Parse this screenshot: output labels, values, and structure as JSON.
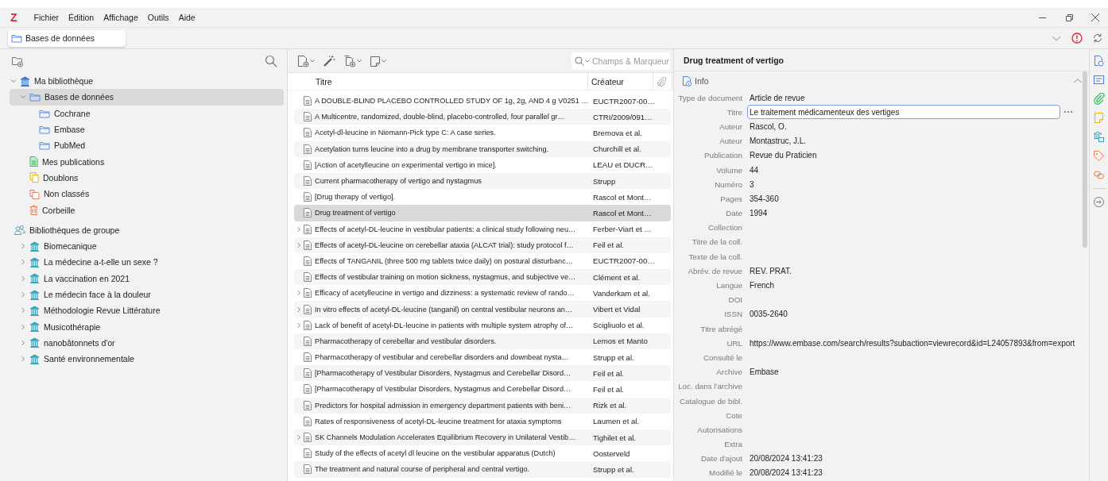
{
  "window": {
    "logo": "Z",
    "menu": [
      "Fichier",
      "Édition",
      "Affichage",
      "Outils",
      "Aide"
    ]
  },
  "tabs": [
    {
      "label": "Bases de données",
      "selected": true
    }
  ],
  "collections": {
    "tree": [
      {
        "label": "Ma bibliothèque",
        "kind": "library",
        "expanded": true,
        "selected": false,
        "children": [
          {
            "label": "Bases de données",
            "kind": "folder",
            "expanded": true,
            "selected": true,
            "children": [
              {
                "label": "Cochrane",
                "kind": "folder",
                "selected": false
              },
              {
                "label": "Embase",
                "kind": "folder",
                "selected": false
              },
              {
                "label": "PubMed",
                "kind": "folder",
                "selected": false
              }
            ]
          },
          {
            "label": "Mes publications",
            "kind": "publications",
            "selected": false
          },
          {
            "label": "Doublons",
            "kind": "duplicates",
            "selected": false
          },
          {
            "label": "Non classés",
            "kind": "unfiled",
            "selected": false
          },
          {
            "label": "Corbeille",
            "kind": "trash",
            "selected": false
          }
        ]
      }
    ],
    "groups_header": "Bibliothèques de groupe",
    "groups": [
      {
        "label": "Biomecanique",
        "kind": "group-library",
        "expanded": false,
        "selected": false
      },
      {
        "label": "La médecine a-t-elle un sexe ?",
        "kind": "group-library",
        "expanded": false,
        "selected": false
      },
      {
        "label": "La vaccination en 2021",
        "kind": "group-library",
        "expanded": false,
        "selected": false
      },
      {
        "label": "Le médecin face à la douleur",
        "kind": "group-library",
        "expanded": false,
        "selected": false
      },
      {
        "label": "Méthodologie Revue Littérature",
        "kind": "group-library",
        "expanded": false,
        "selected": false
      },
      {
        "label": "Musicothérapie",
        "kind": "group-library",
        "expanded": false,
        "selected": false
      },
      {
        "label": "nanobâtonnets d'or",
        "kind": "group-library",
        "expanded": false,
        "selected": false
      },
      {
        "label": "Santé environnementale",
        "kind": "group-library",
        "expanded": false,
        "selected": false
      }
    ]
  },
  "items": {
    "search": {
      "placeholder": "Champs & Marqueur"
    },
    "columns": [
      "Titre",
      "Créateur"
    ],
    "rows": [
      {
        "title": "A DOUBLE-BLIND PLACEBO CONTROLLED STUDY OF 1g, 2g, AND 4 g V0251 …",
        "creator": "EUCTR2007-00…",
        "has_children": false,
        "selected": false
      },
      {
        "title": "A Multicentre, randomized, double-blind, placebo-controlled, four parallel gr…",
        "creator": "CTRI/2009/091…",
        "has_children": false,
        "selected": false
      },
      {
        "title": "Acetyl-dl-leucine in Niemann-Pick type C: A case series.",
        "creator": "Bremova et al.",
        "has_children": false,
        "selected": false
      },
      {
        "title": "Acetylation turns leucine into a drug by membrane transporter switching.",
        "creator": "Churchill et al.",
        "has_children": false,
        "selected": false
      },
      {
        "title": "[Action of acetylleucine on experimental vertigo in mice].",
        "creator": "LEAU et DUCR…",
        "has_children": false,
        "selected": false
      },
      {
        "title": "Current pharmacotherapy of vertigo and nystagmus",
        "creator": "Strupp",
        "has_children": false,
        "selected": false
      },
      {
        "title": "[Drug therapy of vertigo].",
        "creator": "Rascol et Mont…",
        "has_children": false,
        "selected": false
      },
      {
        "title": "Drug treatment of vertigo",
        "creator": "Rascol et Mont…",
        "has_children": false,
        "selected": true
      },
      {
        "title": "Effects of acetyl-DL-leucine in vestibular patients: a clinical study following neu…",
        "creator": "Ferber-Viart et …",
        "has_children": true,
        "selected": false
      },
      {
        "title": "Effects of acetyl-DL-leucine on cerebellar ataxia (ALCAT trial): study protocol f…",
        "creator": "Feil et al.",
        "has_children": true,
        "selected": false
      },
      {
        "title": "Effects of TANGANIL (three 500 mg tablets twice daily) on postural disturbanc…",
        "creator": "EUCTR2007-00…",
        "has_children": false,
        "selected": false
      },
      {
        "title": "Effects of vestibular training on motion sickness, nystagmus, and subjective ve…",
        "creator": "Clément et al.",
        "has_children": false,
        "selected": false
      },
      {
        "title": "Efficacy of acetylleucine in vertigo and dizziness: a systematic review of rando…",
        "creator": "Vanderkam et al.",
        "has_children": true,
        "selected": false
      },
      {
        "title": "In vitro effects of acetyl-DL-leucine (tanganil) on central vestibular neurons an…",
        "creator": "Vibert et Vidal",
        "has_children": true,
        "selected": false
      },
      {
        "title": "Lack of benefit of acetyl-DL-leucine in patients with multiple system atrophy of…",
        "creator": "Scigliuolo et al.",
        "has_children": true,
        "selected": false
      },
      {
        "title": "Pharmacotherapy of cerebellar and vestibular disorders.",
        "creator": "Lemos et Manto",
        "has_children": false,
        "selected": false
      },
      {
        "title": "Pharmacotherapy of vestibular and cerebellar disorders and downbeat nysta…",
        "creator": "Strupp et al.",
        "has_children": false,
        "selected": false
      },
      {
        "title": "[Pharmacotherapy of Vestibular Disorders, Nystagmus and Cerebellar Disord…",
        "creator": "Feil et al.",
        "has_children": false,
        "selected": false
      },
      {
        "title": "[Pharmacotherapy of Vestibular Disorders, Nystagmus and Cerebellar Disord…",
        "creator": "Feil et al.",
        "has_children": false,
        "selected": false
      },
      {
        "title": "Predictors for hospital admission in emergency department patients with beni…",
        "creator": "Rizk et al.",
        "has_children": false,
        "selected": false
      },
      {
        "title": "Rates of responsiveness of acetyl-DL-leucine treatment for ataxia symptoms",
        "creator": "Laumen et al.",
        "has_children": false,
        "selected": false
      },
      {
        "title": "SK Channels Modulation Accelerates Equilibrium Recovery in Unilateral Vestib…",
        "creator": "Tighilet et al.",
        "has_children": true,
        "selected": false
      },
      {
        "title": "Study of the effects of acetyl dl leucine on the vestibular apparatus (Dutch)",
        "creator": "Oosterveld",
        "has_children": false,
        "selected": false
      },
      {
        "title": "The treatment and natural course of peripheral and central vertigo.",
        "creator": "Strupp et al.",
        "has_children": false,
        "selected": false
      }
    ]
  },
  "details": {
    "title": "Drug treatment of vertigo",
    "section": {
      "label": "Info",
      "expanded": true
    },
    "fields": [
      {
        "label": "Type de document",
        "value": "Article de revue",
        "kind": "text"
      },
      {
        "label": "Titre",
        "value": "Le traitement médicamenteux des vertiges",
        "kind": "editing"
      },
      {
        "label": "Auteur",
        "value": "Rascol, O.",
        "kind": "text"
      },
      {
        "label": "Auteur",
        "value": "Montastruc, J.L.",
        "kind": "text"
      },
      {
        "label": "Publication",
        "value": "Revue du Praticien",
        "kind": "text"
      },
      {
        "label": "Volume",
        "value": "44",
        "kind": "text"
      },
      {
        "label": "Numéro",
        "value": "3",
        "kind": "text"
      },
      {
        "label": "Pages",
        "value": "354-360",
        "kind": "text"
      },
      {
        "label": "Date",
        "value": "1994",
        "kind": "text"
      },
      {
        "label": "Collection",
        "kind": "text"
      },
      {
        "label": "Titre de la coll.",
        "kind": "text"
      },
      {
        "label": "Texte de la coll.",
        "kind": "text"
      },
      {
        "label": "Abrév. de revue",
        "value": "REV. PRAT.",
        "kind": "text"
      },
      {
        "label": "Langue",
        "value": "French",
        "kind": "text"
      },
      {
        "label": "DOI",
        "kind": "text"
      },
      {
        "label": "ISSN",
        "value": "0035-2640",
        "kind": "text"
      },
      {
        "label": "Titre abrégé",
        "kind": "text"
      },
      {
        "label": "URL",
        "value": "https://www.embase.com/search/results?subaction=viewrecord&id=L24057893&from=export",
        "kind": "text"
      },
      {
        "label": "Consulté le",
        "kind": "text"
      },
      {
        "label": "Archive",
        "value": "Embase",
        "kind": "text"
      },
      {
        "label": "Loc. dans l'archive",
        "kind": "text"
      },
      {
        "label": "Catalogue de bibl.",
        "kind": "text"
      },
      {
        "label": "Cote",
        "kind": "text"
      },
      {
        "label": "Autorisations",
        "kind": "text"
      },
      {
        "label": "Extra",
        "kind": "text"
      },
      {
        "label": "Date d'ajout",
        "value": "20/08/2024 13:41:23",
        "kind": "text"
      },
      {
        "label": "Modifié le",
        "value": "20/08/2024 13:41:23",
        "kind": "text"
      }
    ]
  }
}
